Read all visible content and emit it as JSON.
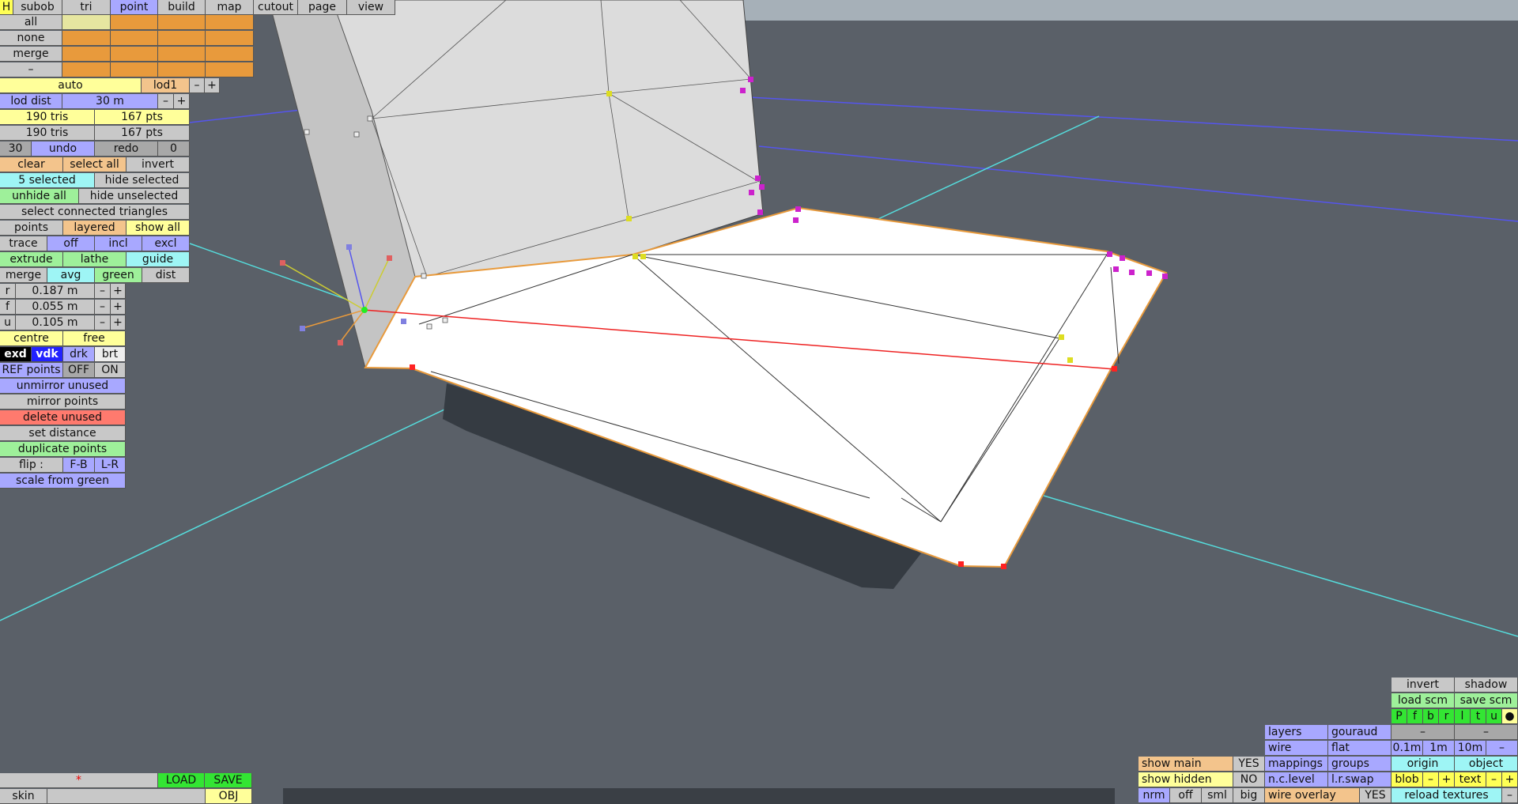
{
  "topbar": {
    "h": "H",
    "tabs": [
      "subob",
      "tri",
      "point",
      "build",
      "map",
      "cutout",
      "page",
      "view"
    ]
  },
  "grid": {
    "rows": [
      "all",
      "none",
      "merge",
      "–"
    ]
  },
  "lod": {
    "auto": "auto",
    "lod1": "lod1",
    "minus": "–",
    "plus": "+",
    "dist_label": "lod dist",
    "dist_value": "30 m",
    "dminus": "–",
    "dplus": "+"
  },
  "stats": {
    "tris1": "190 tris",
    "pts1": "167 pts",
    "tris2": "190 tris",
    "pts2": "167 pts"
  },
  "history": {
    "count": "30",
    "undo": "undo",
    "redo": "redo",
    "redo_count": "0"
  },
  "selection": {
    "clear": "clear",
    "select_all": "select all",
    "invert": "invert",
    "selected": "5 selected",
    "hide_selected": "hide selected",
    "unhide_all": "unhide all",
    "hide_unselected": "hide unselected",
    "select_connected": "select connected triangles"
  },
  "points_row": {
    "points": "points",
    "layered": "layered",
    "show_all": "show all"
  },
  "trace_row": {
    "trace": "trace",
    "off": "off",
    "incl": "incl",
    "excl": "excl"
  },
  "ops_row": {
    "extrude": "extrude",
    "lathe": "lathe",
    "guide": "guide"
  },
  "merge_row": {
    "merge": "merge",
    "avg": "avg",
    "green": "green",
    "dist": "dist"
  },
  "params": [
    {
      "key": "r",
      "value": "0.187 m"
    },
    {
      "key": "f",
      "value": "0.055 m"
    },
    {
      "key": "u",
      "value": "0.105 m"
    }
  ],
  "param_minus": "–",
  "param_plus": "+",
  "centre_row": {
    "centre": "centre",
    "free": "free"
  },
  "render_row": {
    "exd": "exd",
    "vdk": "vdk",
    "drk": "drk",
    "brt": "brt"
  },
  "ref_row": {
    "label": "REF points",
    "off": "OFF",
    "on": "ON"
  },
  "actions": {
    "unmirror": "unmirror unused",
    "mirror": "mirror points",
    "delete": "delete unused",
    "set_distance": "set distance",
    "duplicate": "duplicate points",
    "flip_label": "flip :",
    "flip_fb": "F-B",
    "flip_lr": "L-R",
    "scale": "scale from green"
  },
  "bottom_left": {
    "star": "*",
    "load": "LOAD",
    "save": "SAVE",
    "skin": "skin",
    "obj": "OBJ"
  },
  "bottom_right": {
    "invert": "invert",
    "shadow": "shadow",
    "load_scm": "load scm",
    "save_scm": "save scm",
    "views": [
      "P",
      "f",
      "b",
      "r",
      "l",
      "t",
      "u"
    ],
    "dot": "●",
    "dash": "–",
    "layers": "layers",
    "gouraud": "gouraud",
    "wire": "wire",
    "flat": "flat",
    "d01": "0.1m",
    "d1": "1m",
    "d10": "10m",
    "show_main": "show main",
    "yes1": "YES",
    "mappings": "mappings",
    "groups": "groups",
    "origin": "origin",
    "object": "object",
    "show_hidden": "show hidden",
    "no1": "NO",
    "nclevel": "n.c.level",
    "lrswap": "l.r.swap",
    "blob": "blob",
    "text": "text",
    "plus": "+",
    "nrm": "nrm",
    "off": "off",
    "sml": "sml",
    "big": "big",
    "wire_overlay": "wire overlay",
    "yes2": "YES",
    "reload": "reload textures"
  },
  "colors": {
    "background": "#5a6068",
    "mesh": "#ffffff",
    "accent": "#e89a3c",
    "selected_point": "#ff2222",
    "point_magenta": "#cc22cc",
    "point_yellow": "#dddd22"
  }
}
